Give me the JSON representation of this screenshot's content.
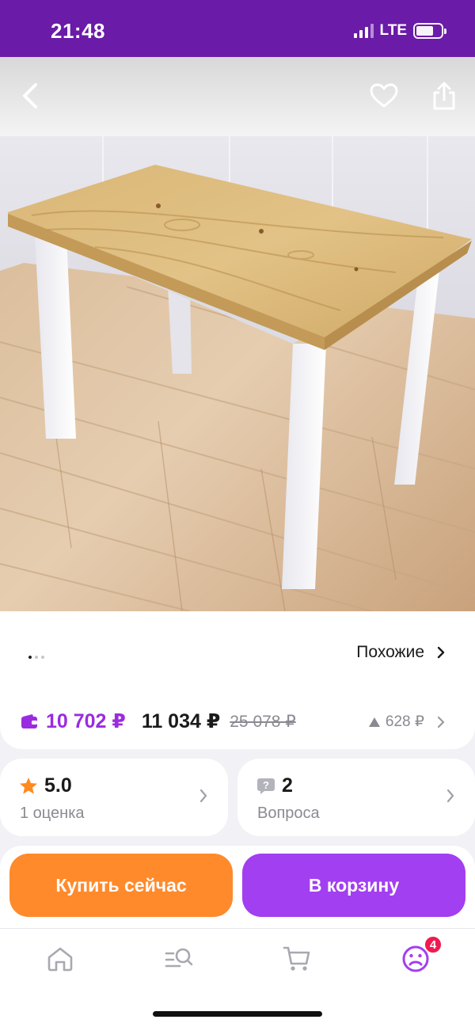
{
  "status": {
    "time": "21:48",
    "network": "LTE",
    "battery_level": 0.7
  },
  "gallery": {
    "page_count": 3,
    "active_page": 1,
    "similar_label": "Похожие"
  },
  "prices": {
    "wallet_price": "10 702 ₽",
    "price": "11 034 ₽",
    "old_price": "25 078 ₽",
    "change": "628 ₽"
  },
  "rating": {
    "value": "5.0",
    "caption": "1 оценка"
  },
  "questions": {
    "count": "2",
    "caption": "Вопроса"
  },
  "actions": {
    "buy_now": "Купить сейчас",
    "add_to_cart": "В корзину"
  },
  "tabbar": {
    "items": [
      "home-icon",
      "catalog-search-icon",
      "cart-icon",
      "profile-icon"
    ],
    "profile_badge": "4"
  },
  "colors": {
    "status_bar": "#6a1ba7",
    "accent_purple": "#a23ff1",
    "wallet_purple": "#9b2be0",
    "buy_orange": "#ff8a2b",
    "rating_star": "#ff8a1f",
    "badge_red": "#f01a50"
  }
}
